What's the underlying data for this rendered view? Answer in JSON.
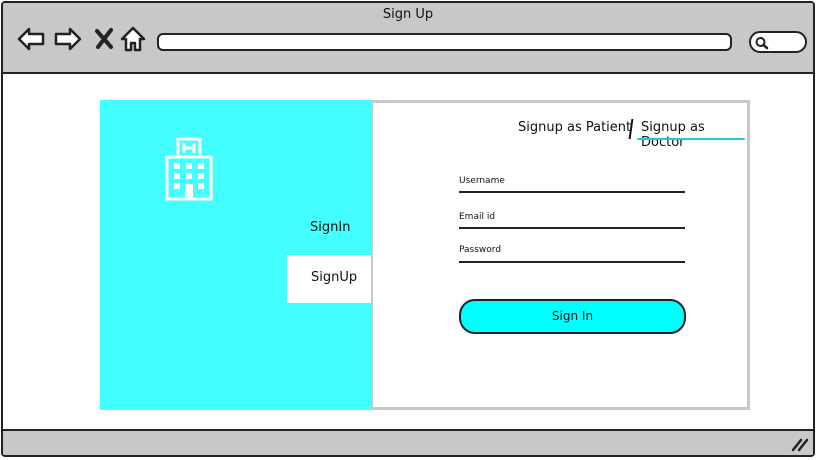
{
  "window": {
    "title": "Sign Up"
  },
  "browser": {
    "back_icon": "back-arrow-icon",
    "forward_icon": "forward-arrow-icon",
    "close_icon": "close-icon",
    "home_icon": "home-icon",
    "search_icon": "search-icon",
    "url_value": ""
  },
  "sidebar": {
    "logo_icon": "hospital-icon",
    "items": [
      {
        "label": "SignIn"
      },
      {
        "label": "SignUp",
        "active": true
      }
    ],
    "background_color": "#44ffff"
  },
  "tabs": {
    "patient_label": "Signup as Patient",
    "doctor_label": "Signup as Doctor",
    "active": "doctor",
    "accent_color": "#1ec8d8"
  },
  "form": {
    "username_label": "Username",
    "email_label": "Email id",
    "password_label": "Password",
    "submit_label": "Sign In",
    "submit_color": "#00ffff"
  }
}
